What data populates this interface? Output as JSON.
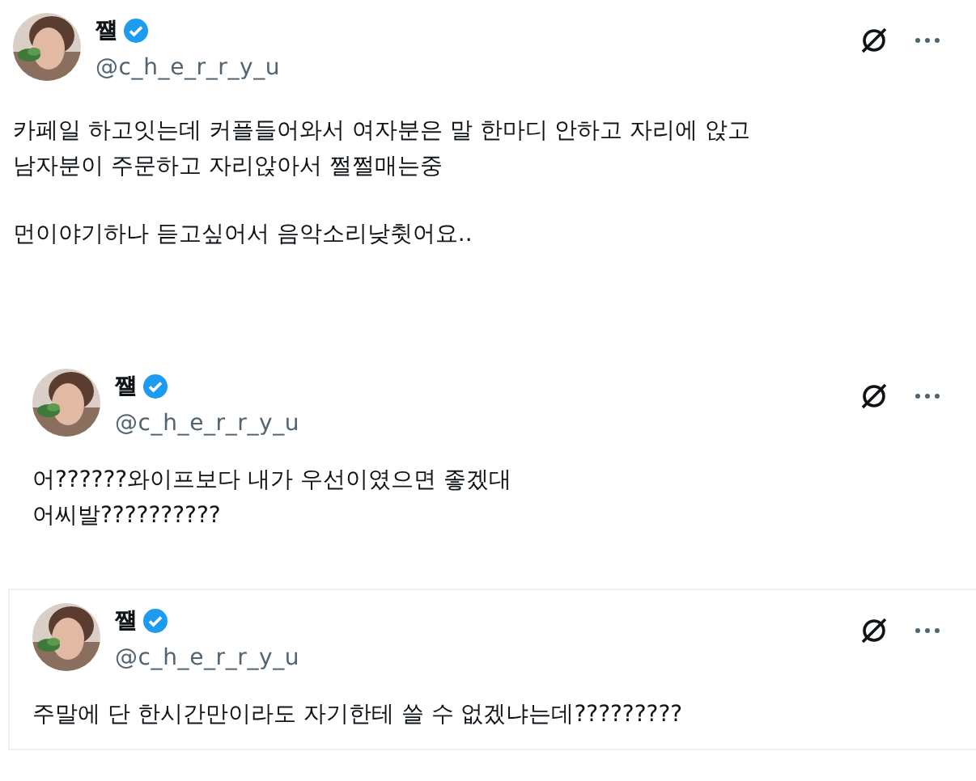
{
  "tweets": [
    {
      "name": "쨸",
      "verified": true,
      "handle": "@c_h_e_r_r_y_u",
      "paragraphs": [
        "카페일 하고잇는데 커플들어와서 여자분은 말 한마디 안하고 자리에 앉고\n남자분이 주문하고 자리앉아서 쩔쩔매는중",
        "먼이야기하나 듣고싶어서 음악소리낮췻어요.."
      ]
    },
    {
      "name": "쨸",
      "verified": true,
      "handle": "@c_h_e_r_r_y_u",
      "paragraphs": [
        "어??????와이프보다 내가 우선이였으면 좋겠대\n어씨발??????????"
      ]
    },
    {
      "name": "쨸",
      "verified": true,
      "handle": "@c_h_e_r_r_y_u",
      "paragraphs": [
        "주말에 단 한시간만이라도 자기한테 쓸 수 없겠냐는데?????????"
      ]
    }
  ]
}
